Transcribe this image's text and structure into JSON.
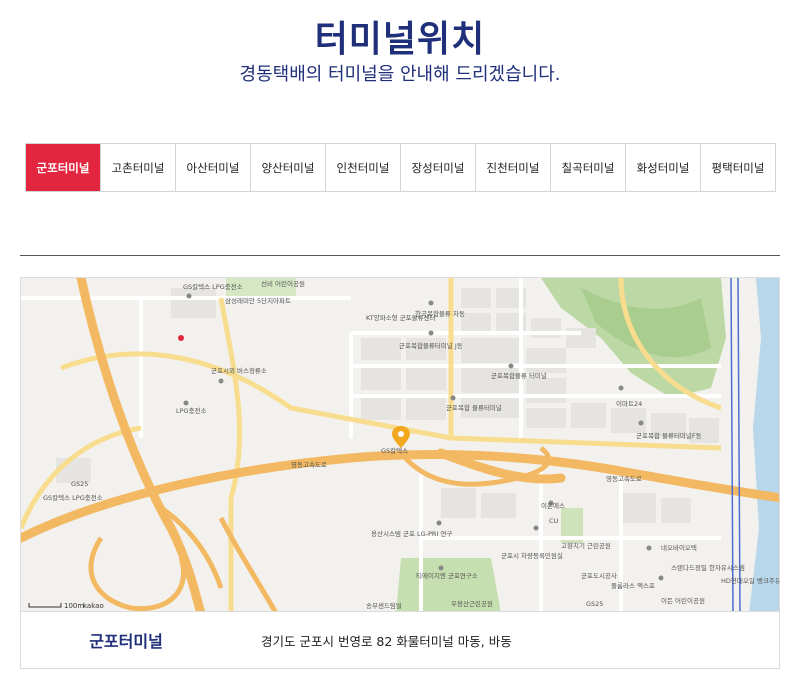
{
  "header": {
    "title": "터미널위치",
    "subtitle": "경동택배의 터미널을 안내해 드리겠습니다."
  },
  "tabs": [
    {
      "label": "군포터미널",
      "active": true
    },
    {
      "label": "고촌터미널",
      "active": false
    },
    {
      "label": "아산터미널",
      "active": false
    },
    {
      "label": "양산터미널",
      "active": false
    },
    {
      "label": "인천터미널",
      "active": false
    },
    {
      "label": "장성터미널",
      "active": false
    },
    {
      "label": "진천터미널",
      "active": false
    },
    {
      "label": "칠곡터미널",
      "active": false
    },
    {
      "label": "화성터미널",
      "active": false
    },
    {
      "label": "평택터미널",
      "active": false
    }
  ],
  "map": {
    "scale": "100m",
    "provider": "kakao",
    "labels": {
      "gs_lpg_1": "GS칼텍스 LPG충전소",
      "samsung_apt": "삼성래미안 5단지아파트",
      "seonbi_park": "선비 어린이공원",
      "kt": "KT양파소형 군포물류센터",
      "korea_complex": "한국복합물류 차동",
      "korea_complex_j": "군포복합물류터미널 J동",
      "gunpo_bus": "군포시외 버스정류소",
      "lpg_station": "LPG충전소",
      "complex_terminal": "군포복합물류 터미널",
      "complex_terminal_2": "군포복합 물류터미널",
      "emart24": "이마트24",
      "complex_f": "군포복합 물류터미널F동",
      "gs_caltex": "GS칼텍스",
      "gs25_1": "GS25",
      "gs_lpg_2": "GS칼텍스 LPG충전소",
      "yongsan": "용산시스템 군포 LG-PRI 연구",
      "eon": "이온에스",
      "cu": "CU",
      "gunpo_vehicle": "군포시 차량등록민원실",
      "gold_park": "고향치기 근린공원",
      "neo_bio": "네오바이오텍",
      "standard": "스탠다드정밀 한자유시스템",
      "gs25_2": "GS25",
      "hd_hyundai": "HD현대오일 뱅크주유소",
      "flower": "플롬라스 엑스포",
      "eden_park": "이든 어린이공원",
      "hyundai_lab": "티에이지엔 군포연구소",
      "uwangsan": "우왕산근린공원",
      "gunpo_city": "군포도시공사",
      "songbu": "송부센드팀빌",
      "highway": "영동고속도로",
      "highway_2": "영동고속도로"
    }
  },
  "info": {
    "name": "군포터미널",
    "address": "경기도 군포시 번영로 82 화물터미널 마동, 바동"
  },
  "colors": {
    "accent_red": "#e3263f",
    "navy": "#1f2f7a",
    "road_major": "#f3b862",
    "road_minor": "#ffffff",
    "green": "#bcd8a4",
    "water": "#b9d7ea"
  }
}
